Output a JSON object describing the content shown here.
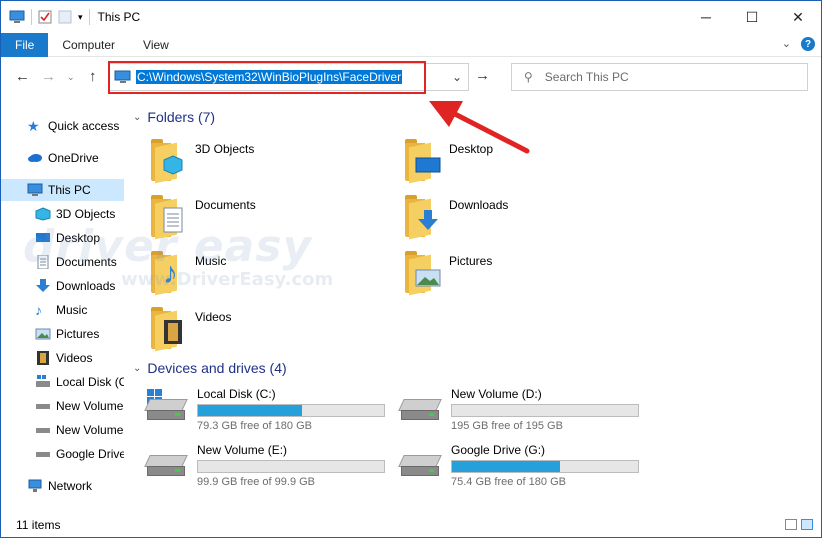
{
  "window": {
    "title": "This PC"
  },
  "ribbon": {
    "tabs": [
      "File",
      "Computer",
      "View"
    ]
  },
  "address": {
    "path": "C:\\Windows\\System32\\WinBioPlugIns\\FaceDriver"
  },
  "search": {
    "placeholder": "Search This PC"
  },
  "sidebar": {
    "items": [
      "Quick access",
      "OneDrive",
      "This PC",
      "3D Objects",
      "Desktop",
      "Documents",
      "Downloads",
      "Music",
      "Pictures",
      "Videos",
      "Local Disk (C:)",
      "New Volume (D:)",
      "New Volume (E:)",
      "Google Drive (G:)",
      "Network"
    ]
  },
  "folders": {
    "heading": "Folders (7)",
    "items": [
      "3D Objects",
      "Desktop",
      "Documents",
      "Downloads",
      "Music",
      "Pictures",
      "Videos"
    ]
  },
  "drives": {
    "heading": "Devices and drives (4)",
    "items": [
      {
        "name": "Local Disk (C:)",
        "free": "79.3 GB free of 180 GB",
        "used_fraction": 0.56
      },
      {
        "name": "New Volume (D:)",
        "free": "195 GB free of 195 GB",
        "used_fraction": 0.0
      },
      {
        "name": "New Volume (E:)",
        "free": "99.9 GB free of 99.9 GB",
        "used_fraction": 0.0
      },
      {
        "name": "Google Drive (G:)",
        "free": "75.4 GB free of 180 GB",
        "used_fraction": 0.58
      }
    ]
  },
  "status": {
    "count": "11 items"
  },
  "watermark": {
    "brand": "driver easy",
    "url": "www.DriverEasy.com"
  },
  "colors": {
    "accent": "#0078d7",
    "file_tab": "#1979ca",
    "highlight": "#e02424",
    "bar": "#26a0da",
    "selected": "#cce8ff"
  }
}
